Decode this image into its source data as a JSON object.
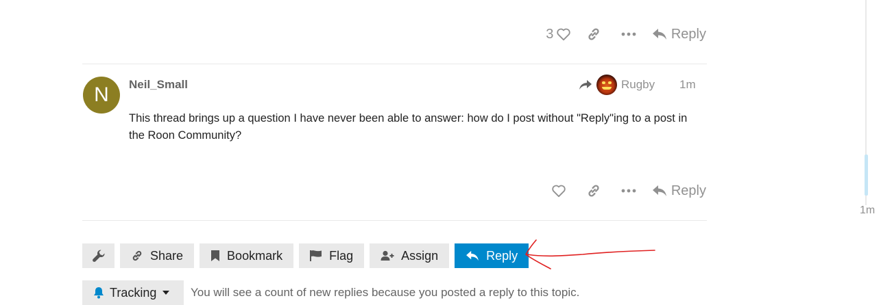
{
  "previous_post": {
    "like_count": "3",
    "reply_label": "Reply"
  },
  "post": {
    "avatar_letter": "N",
    "avatar_color": "#8c7e22",
    "username": "Neil_Small",
    "reply_to_user": "Rugby",
    "date": "1m",
    "body": "This thread brings up a question I have never been able to answer: how do I post without \"Reply\"ing to a post in the Roon Community?",
    "reply_label": "Reply"
  },
  "footer": {
    "share_label": "Share",
    "bookmark_label": "Bookmark",
    "flag_label": "Flag",
    "assign_label": "Assign",
    "reply_label": "Reply",
    "primary_color": "#0088cc"
  },
  "notifications": {
    "level_label": "Tracking",
    "reason": "You will see a count of new replies because you posted a reply to this topic."
  },
  "timeline": {
    "date": "1m"
  },
  "icons": {
    "like": "heart-icon",
    "link": "link-icon",
    "more": "ellipsis-icon",
    "reply": "reply-arrow-icon",
    "admin": "wrench-icon",
    "bookmark": "bookmark-icon",
    "flag": "flag-icon",
    "assign": "user-plus-icon",
    "tracking": "bell-icon"
  },
  "annotation_color": "#e02020"
}
